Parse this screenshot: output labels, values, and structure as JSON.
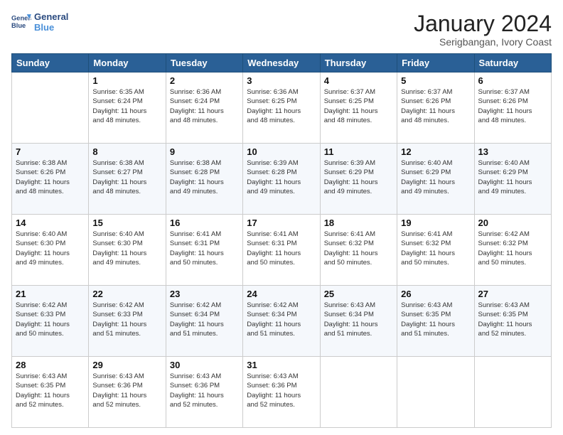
{
  "logo": {
    "line1": "General",
    "line2": "Blue"
  },
  "title": "January 2024",
  "subtitle": "Serigbangan, Ivory Coast",
  "days_of_week": [
    "Sunday",
    "Monday",
    "Tuesday",
    "Wednesday",
    "Thursday",
    "Friday",
    "Saturday"
  ],
  "weeks": [
    [
      {
        "day": "",
        "info": ""
      },
      {
        "day": "1",
        "info": "Sunrise: 6:35 AM\nSunset: 6:24 PM\nDaylight: 11 hours\nand 48 minutes."
      },
      {
        "day": "2",
        "info": "Sunrise: 6:36 AM\nSunset: 6:24 PM\nDaylight: 11 hours\nand 48 minutes."
      },
      {
        "day": "3",
        "info": "Sunrise: 6:36 AM\nSunset: 6:25 PM\nDaylight: 11 hours\nand 48 minutes."
      },
      {
        "day": "4",
        "info": "Sunrise: 6:37 AM\nSunset: 6:25 PM\nDaylight: 11 hours\nand 48 minutes."
      },
      {
        "day": "5",
        "info": "Sunrise: 6:37 AM\nSunset: 6:26 PM\nDaylight: 11 hours\nand 48 minutes."
      },
      {
        "day": "6",
        "info": "Sunrise: 6:37 AM\nSunset: 6:26 PM\nDaylight: 11 hours\nand 48 minutes."
      }
    ],
    [
      {
        "day": "7",
        "info": "Sunrise: 6:38 AM\nSunset: 6:26 PM\nDaylight: 11 hours\nand 48 minutes."
      },
      {
        "day": "8",
        "info": "Sunrise: 6:38 AM\nSunset: 6:27 PM\nDaylight: 11 hours\nand 48 minutes."
      },
      {
        "day": "9",
        "info": "Sunrise: 6:38 AM\nSunset: 6:28 PM\nDaylight: 11 hours\nand 49 minutes."
      },
      {
        "day": "10",
        "info": "Sunrise: 6:39 AM\nSunset: 6:28 PM\nDaylight: 11 hours\nand 49 minutes."
      },
      {
        "day": "11",
        "info": "Sunrise: 6:39 AM\nSunset: 6:29 PM\nDaylight: 11 hours\nand 49 minutes."
      },
      {
        "day": "12",
        "info": "Sunrise: 6:40 AM\nSunset: 6:29 PM\nDaylight: 11 hours\nand 49 minutes."
      },
      {
        "day": "13",
        "info": "Sunrise: 6:40 AM\nSunset: 6:29 PM\nDaylight: 11 hours\nand 49 minutes."
      }
    ],
    [
      {
        "day": "14",
        "info": "Sunrise: 6:40 AM\nSunset: 6:30 PM\nDaylight: 11 hours\nand 49 minutes."
      },
      {
        "day": "15",
        "info": "Sunrise: 6:40 AM\nSunset: 6:30 PM\nDaylight: 11 hours\nand 49 minutes."
      },
      {
        "day": "16",
        "info": "Sunrise: 6:41 AM\nSunset: 6:31 PM\nDaylight: 11 hours\nand 50 minutes."
      },
      {
        "day": "17",
        "info": "Sunrise: 6:41 AM\nSunset: 6:31 PM\nDaylight: 11 hours\nand 50 minutes."
      },
      {
        "day": "18",
        "info": "Sunrise: 6:41 AM\nSunset: 6:32 PM\nDaylight: 11 hours\nand 50 minutes."
      },
      {
        "day": "19",
        "info": "Sunrise: 6:41 AM\nSunset: 6:32 PM\nDaylight: 11 hours\nand 50 minutes."
      },
      {
        "day": "20",
        "info": "Sunrise: 6:42 AM\nSunset: 6:32 PM\nDaylight: 11 hours\nand 50 minutes."
      }
    ],
    [
      {
        "day": "21",
        "info": "Sunrise: 6:42 AM\nSunset: 6:33 PM\nDaylight: 11 hours\nand 50 minutes."
      },
      {
        "day": "22",
        "info": "Sunrise: 6:42 AM\nSunset: 6:33 PM\nDaylight: 11 hours\nand 51 minutes."
      },
      {
        "day": "23",
        "info": "Sunrise: 6:42 AM\nSunset: 6:34 PM\nDaylight: 11 hours\nand 51 minutes."
      },
      {
        "day": "24",
        "info": "Sunrise: 6:42 AM\nSunset: 6:34 PM\nDaylight: 11 hours\nand 51 minutes."
      },
      {
        "day": "25",
        "info": "Sunrise: 6:43 AM\nSunset: 6:34 PM\nDaylight: 11 hours\nand 51 minutes."
      },
      {
        "day": "26",
        "info": "Sunrise: 6:43 AM\nSunset: 6:35 PM\nDaylight: 11 hours\nand 51 minutes."
      },
      {
        "day": "27",
        "info": "Sunrise: 6:43 AM\nSunset: 6:35 PM\nDaylight: 11 hours\nand 52 minutes."
      }
    ],
    [
      {
        "day": "28",
        "info": "Sunrise: 6:43 AM\nSunset: 6:35 PM\nDaylight: 11 hours\nand 52 minutes."
      },
      {
        "day": "29",
        "info": "Sunrise: 6:43 AM\nSunset: 6:36 PM\nDaylight: 11 hours\nand 52 minutes."
      },
      {
        "day": "30",
        "info": "Sunrise: 6:43 AM\nSunset: 6:36 PM\nDaylight: 11 hours\nand 52 minutes."
      },
      {
        "day": "31",
        "info": "Sunrise: 6:43 AM\nSunset: 6:36 PM\nDaylight: 11 hours\nand 52 minutes."
      },
      {
        "day": "",
        "info": ""
      },
      {
        "day": "",
        "info": ""
      },
      {
        "day": "",
        "info": ""
      }
    ]
  ]
}
